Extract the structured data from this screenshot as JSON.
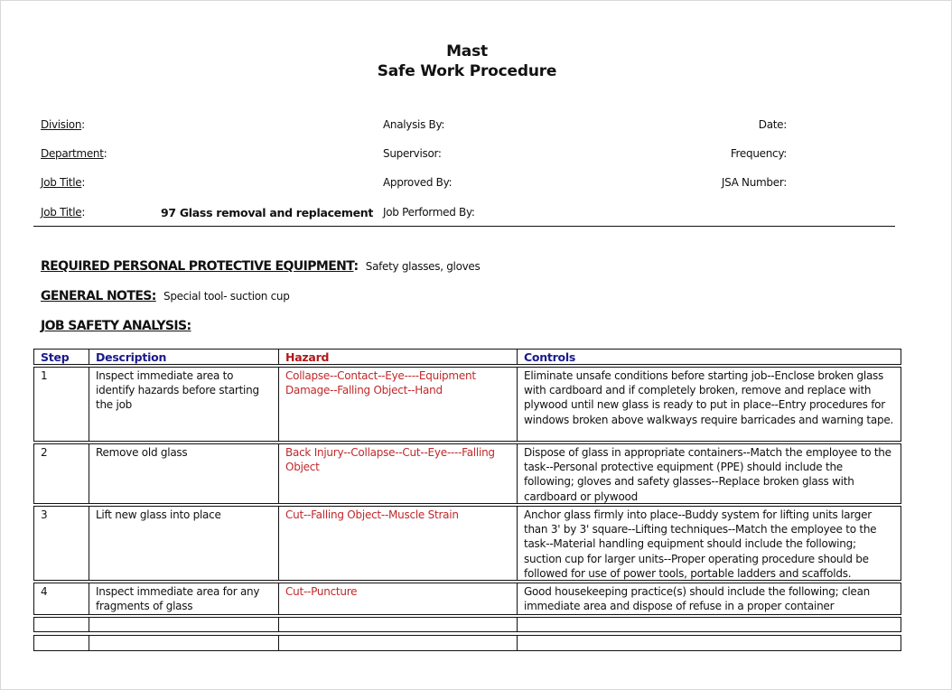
{
  "document": {
    "title_line1": "Mast",
    "title_line2": "Safe Work Procedure"
  },
  "header_fields": {
    "division_label": "Division",
    "department_label": "Department",
    "job_title_label_1": "Job Title",
    "job_title_label_2": "Job Title",
    "job_title_value": "97 Glass removal and replacement",
    "analysis_by_label": "Analysis By:",
    "supervisor_label": "Supervisor:",
    "approved_by_label": "Approved By:",
    "job_performed_by_label": "Job Performed  By:",
    "date_label": "Date:",
    "frequency_label": "Frequency:",
    "jsa_number_label": "JSA Number:",
    "colon": ":"
  },
  "sections": {
    "ppe_heading": "REQUIRED PERSONAL PROTECTIVE EQUIPMENT",
    "ppe_value": "Safety glasses, gloves",
    "notes_heading": "GENERAL NOTES:",
    "notes_value": "Special tool- suction cup",
    "jsa_heading": "JOB SAFETY ANALYSIS:"
  },
  "table": {
    "columns": [
      "Step",
      "Description",
      "Hazard",
      "Controls"
    ],
    "rows": [
      {
        "step": "1",
        "description": "Inspect immediate area to identify hazards before starting the job",
        "hazard": "Collapse--Contact--Eye----Equipment Damage--Falling Object--Hand",
        "controls": "Eliminate unsafe conditions  before starting job--Enclose broken glass with cardboard and if completely broken, remove and replace with plywood until new glass is ready to put in place--Entry procedures for windows broken above walkways require barricades and warning tape."
      },
      {
        "step": "2",
        "description": "Remove old glass",
        "hazard": "Back Injury--Collapse--Cut--Eye----Falling Object",
        "controls": "Dispose of glass in appropriate containers--Match  the employee to the task--Personal protective equipment (PPE) should include the following; gloves and safety glasses--Replace broken glass with cardboard or plywood"
      },
      {
        "step": "3",
        "description": "Lift new glass into place",
        "hazard": "Cut--Falling Object--Muscle Strain",
        "controls": "Anchor glass firmly into place--Buddy system for lifting  units larger than 3' by 3' square--Lifting techniques--Match the employee to the task--Material handling equipment should include the following; suction cup for larger units--Proper operating procedure should be followed for use of power tools, portable ladders and scaffolds."
      },
      {
        "step": "4",
        "description": "Inspect immediate area for any fragments of glass",
        "hazard": "Cut--Puncture",
        "controls": "Good housekeeping practice(s) should include the following; clean immediate area and dispose of refuse in a proper container"
      },
      {
        "step": "",
        "description": "",
        "hazard": "",
        "controls": ""
      },
      {
        "step": "",
        "description": "",
        "hazard": "",
        "controls": ""
      }
    ]
  }
}
